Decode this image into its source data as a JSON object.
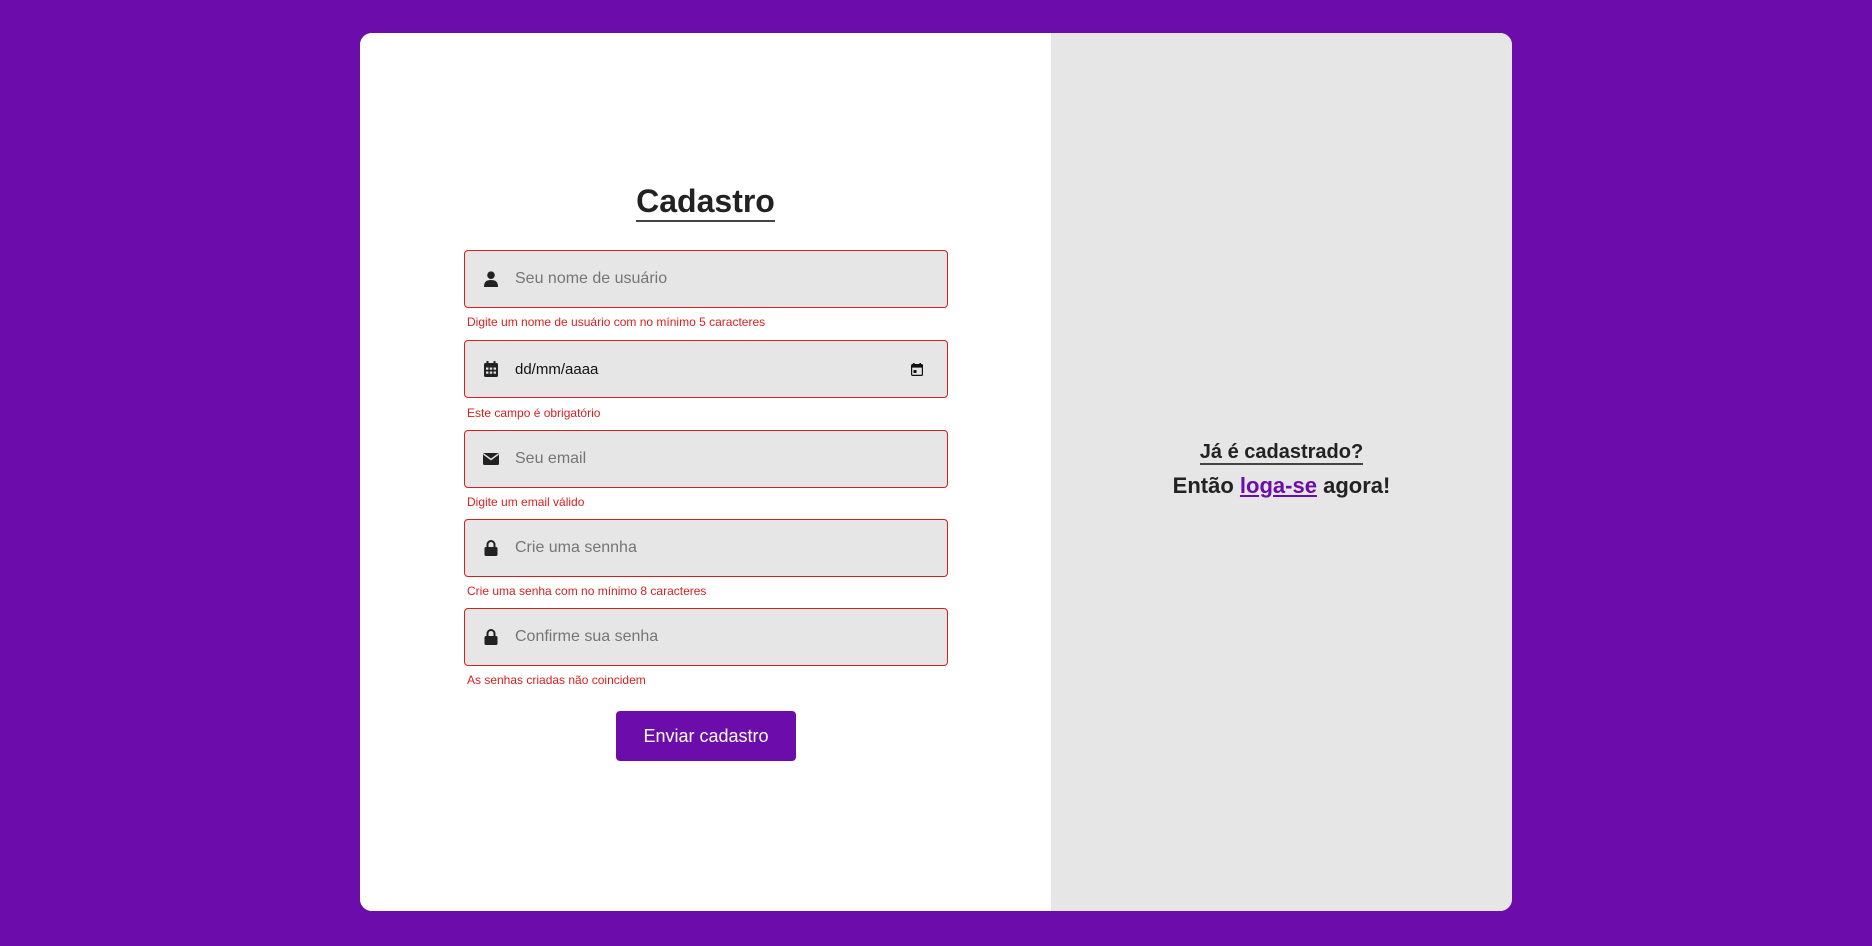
{
  "form": {
    "title": "Cadastro",
    "fields": [
      {
        "icon": "user-icon",
        "placeholder": "Seu nome de usuário",
        "value": "",
        "error": "Digite um nome de usuário com no mínimo 5 caracteres"
      },
      {
        "icon": "calendar-icon",
        "placeholder": "",
        "value": "dd/mm/aaaa",
        "error": "Este campo é obrigatório"
      },
      {
        "icon": "envelope-icon",
        "placeholder": "Seu email",
        "value": "",
        "error": "Digite um email válido"
      },
      {
        "icon": "lock-icon",
        "placeholder": "Crie uma sennha",
        "value": "",
        "error": "Crie uma senha com no mínimo 8 caracteres"
      },
      {
        "icon": "lock-icon",
        "placeholder": "Confirme sua senha",
        "value": "",
        "error": "As senhas criadas não coincidem"
      }
    ],
    "submit_label": "Enviar cadastro"
  },
  "side": {
    "question": "Já é cadastrado?",
    "line_prefix": "Então",
    "link_label": "loga-se",
    "line_suffix": "agora!"
  },
  "colors": {
    "background": "#6c0dab",
    "accent": "#6c0dab",
    "error": "#d61f1f",
    "field_bg": "#e6e6e6",
    "side_bg": "#e6e6e6"
  }
}
